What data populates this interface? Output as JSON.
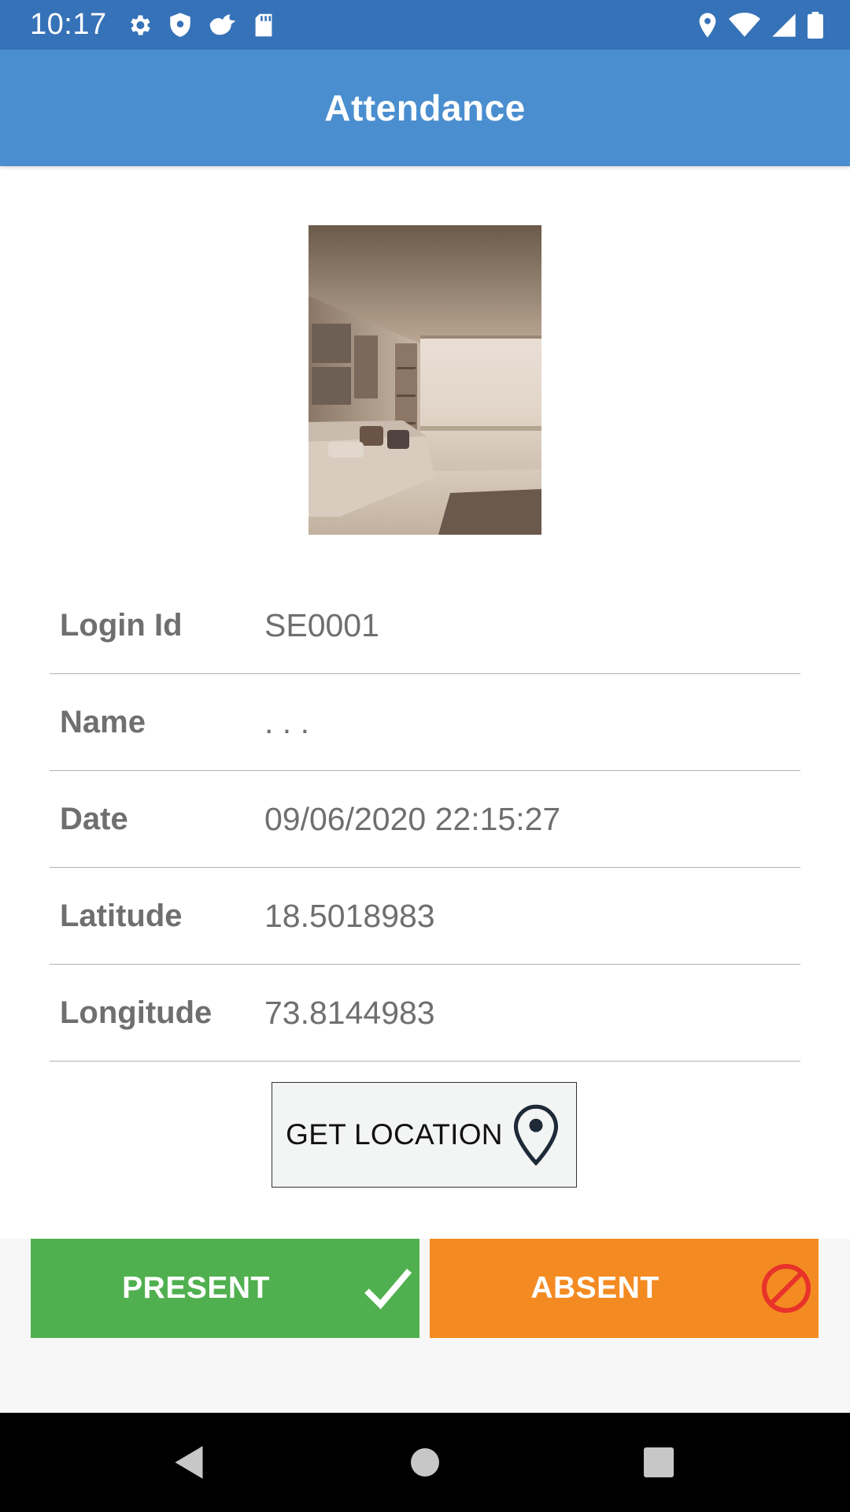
{
  "status_bar": {
    "time": "10:17",
    "icons_left": [
      "settings-icon",
      "shield-icon",
      "bird-icon",
      "sd-card-icon"
    ],
    "icons_right": [
      "location-icon",
      "wifi-icon",
      "signal-icon",
      "battery-icon"
    ]
  },
  "app_bar": {
    "title": "Attendance"
  },
  "photo": {
    "description_icon": "room-photo"
  },
  "info": {
    "rows": [
      {
        "label": "Login Id",
        "value": "SE0001"
      },
      {
        "label": "Name",
        "value": ". . ."
      },
      {
        "label": "Date",
        "value": "09/06/2020 22:15:27"
      },
      {
        "label": "Latitude",
        "value": "18.5018983"
      },
      {
        "label": "Longitude",
        "value": "73.8144983"
      }
    ]
  },
  "location_button": {
    "label": "GET LOCATION",
    "icon": "map-pin-icon"
  },
  "actions": {
    "present_label": "PRESENT",
    "present_icon": "check-icon",
    "present_color": "#50b04f",
    "absent_label": "ABSENT",
    "absent_icon": "block-icon",
    "absent_color": "#f38b22"
  },
  "nav_bar": {
    "items": [
      "back-icon",
      "home-icon",
      "recents-icon"
    ]
  },
  "colors": {
    "status_bar": "#3672b8",
    "app_bar": "#4a8ecf",
    "text_gray": "#6f6f6f"
  }
}
